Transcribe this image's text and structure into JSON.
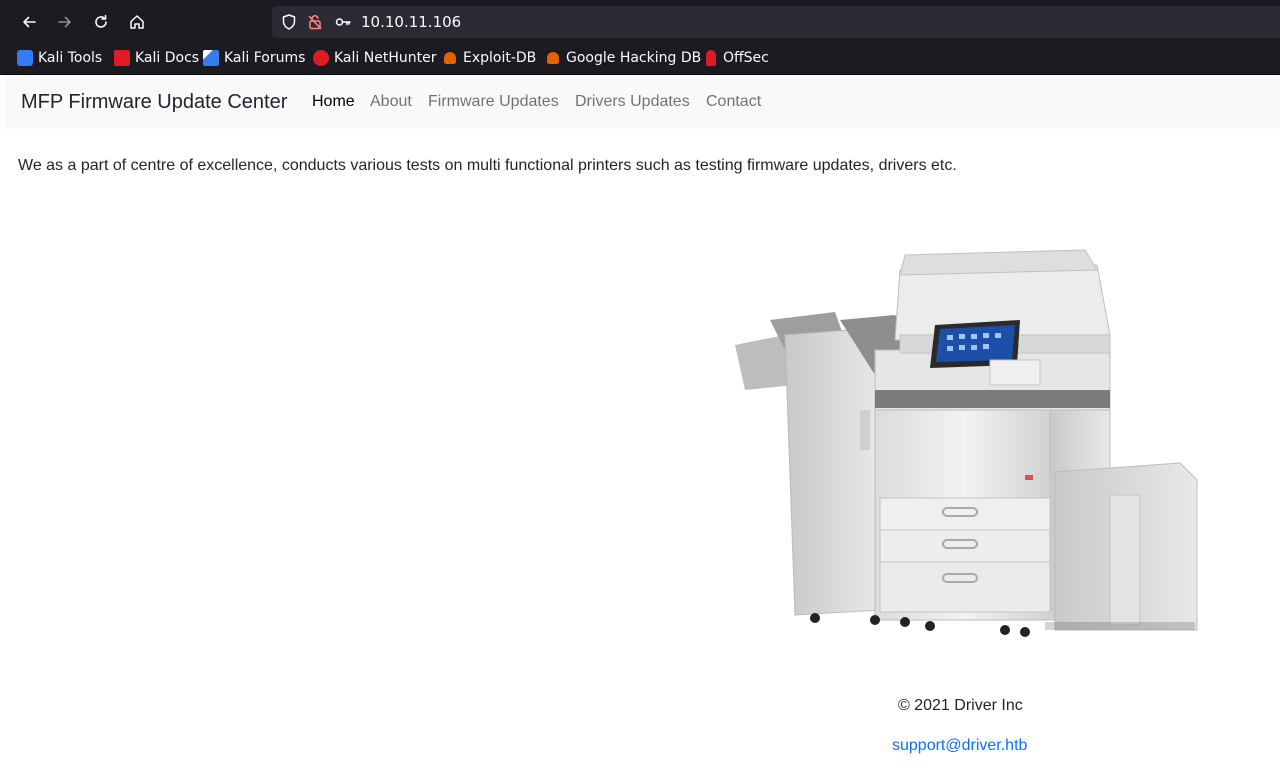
{
  "browser": {
    "url": "10.10.11.106",
    "bookmarks": [
      {
        "label": "Kali Tools",
        "icon": "kali-tools-icon",
        "color": "#367bf0"
      },
      {
        "label": "Kali Docs",
        "icon": "kali-docs-icon",
        "color": "#e01b24"
      },
      {
        "label": "Kali Forums",
        "icon": "kali-forums-icon",
        "color": "#367bf0"
      },
      {
        "label": "Kali NetHunter",
        "icon": "kali-nethunter-icon",
        "color": "#e01b24"
      },
      {
        "label": "Exploit-DB",
        "icon": "exploit-db-icon",
        "color": "#e66100"
      },
      {
        "label": "Google Hacking DB",
        "icon": "google-hacking-db-icon",
        "color": "#e66100"
      },
      {
        "label": "OffSec",
        "icon": "offsec-icon",
        "color": "#e01b24"
      }
    ]
  },
  "site": {
    "brand": "MFP Firmware Update Center",
    "nav": [
      {
        "label": "Home",
        "active": true
      },
      {
        "label": "About",
        "active": false
      },
      {
        "label": "Firmware Updates",
        "active": false
      },
      {
        "label": "Drivers Updates",
        "active": false
      },
      {
        "label": "Contact",
        "active": false
      }
    ],
    "intro": "We as a part of centre of excellence, conducts various tests on multi functional printers such as testing firmware updates, drivers etc.",
    "footer": {
      "copyright": "© 2021 Driver Inc",
      "email": "support@driver.htb"
    },
    "link_color": "#0d6efd"
  }
}
